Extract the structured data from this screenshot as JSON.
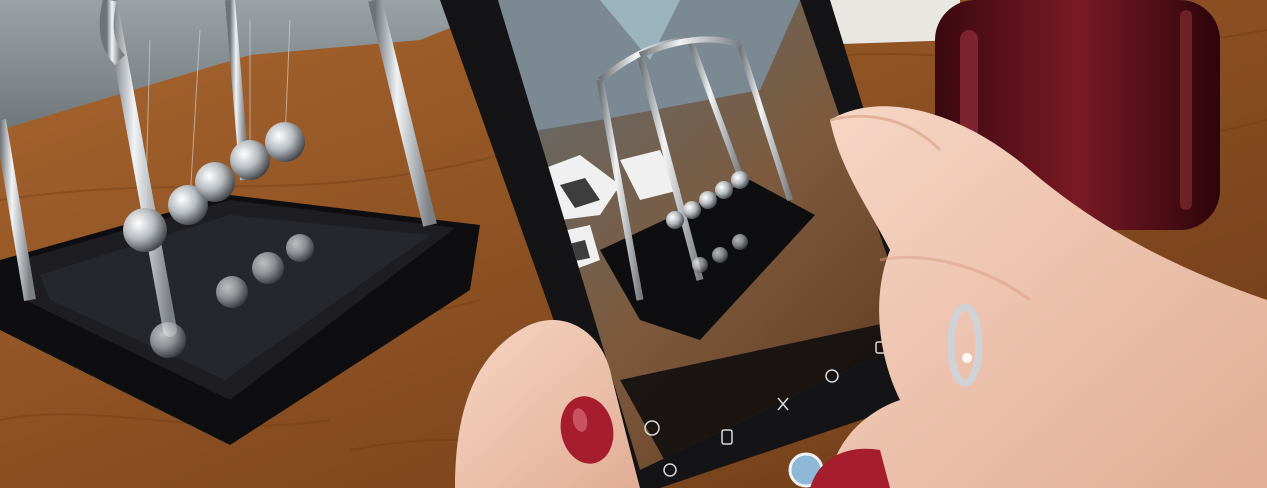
{
  "scene": {
    "alt": "",
    "colors": {
      "table": "#9a5b2a",
      "table_dark": "#6e3d18",
      "wall": "#8d9498",
      "chrome": "#c9cdd1",
      "phone_body": "#1a1a1c",
      "skin": "#f0c7b2",
      "nail": "#a61e2e",
      "glass_red": "#5a0f18",
      "base_black": "#111114"
    },
    "camera_ui": {
      "icons": [
        "flash-icon",
        "settings-icon",
        "gallery-icon",
        "mode-icon",
        "shutter-button",
        "filter-icon",
        "switch-camera-icon"
      ]
    }
  }
}
